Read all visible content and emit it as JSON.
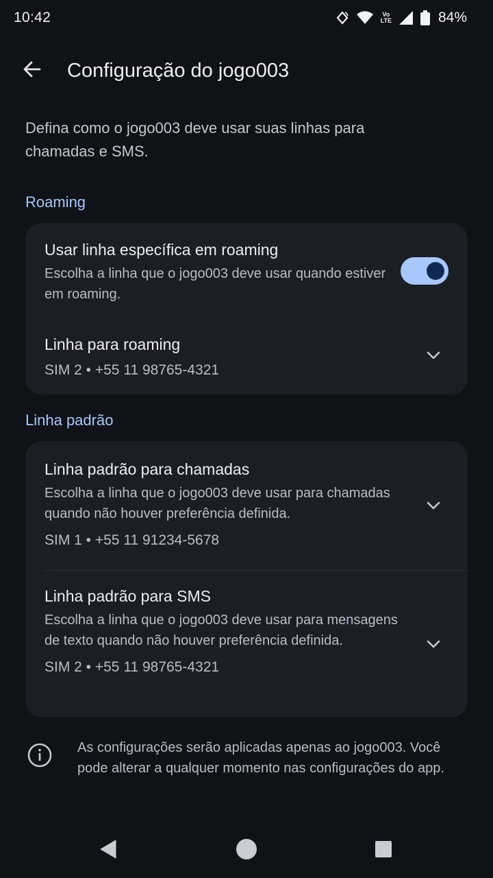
{
  "status_bar": {
    "time": "10:42",
    "volte_top": "Vo",
    "volte_bottom": "LTE",
    "battery_percent": "84%"
  },
  "app_bar": {
    "back_icon": "arrow-back-icon",
    "title": "Configuração do jogo003"
  },
  "intro": "Defina como o jogo003 deve usar suas linhas para chamadas e SMS.",
  "roaming_section": {
    "label": "Roaming",
    "toggle_row": {
      "title": "Usar linha específica em roaming",
      "subtitle": "Escolha a linha que o jogo003 deve usar quando estiver em roaming.",
      "enabled": true
    },
    "line_row": {
      "title": "Linha para roaming",
      "value": "SIM 2 • +55 11 98765-4321"
    }
  },
  "default_section": {
    "label": "Linha padrão",
    "calls_row": {
      "title": "Linha padrão para chamadas",
      "subtitle": "Escolha a linha que o jogo003 deve usar para chamadas quando não houver preferência definida.",
      "value": "SIM 1 • +55 11 91234-5678"
    },
    "sms_row": {
      "title": "Linha padrão para SMS",
      "subtitle": "Escolha a linha que o jogo003 deve usar para mensagens de texto quando não houver preferência definida.",
      "value": "SIM 2 • +55 11 98765-4321"
    }
  },
  "info_note": "As configurações serão aplicadas apenas ao jogo003. Você pode alterar a qualquer momento nas configurações do app.",
  "colors": {
    "background": "#0f1216",
    "card": "#1b1f25",
    "accent": "#a8c7fa"
  }
}
